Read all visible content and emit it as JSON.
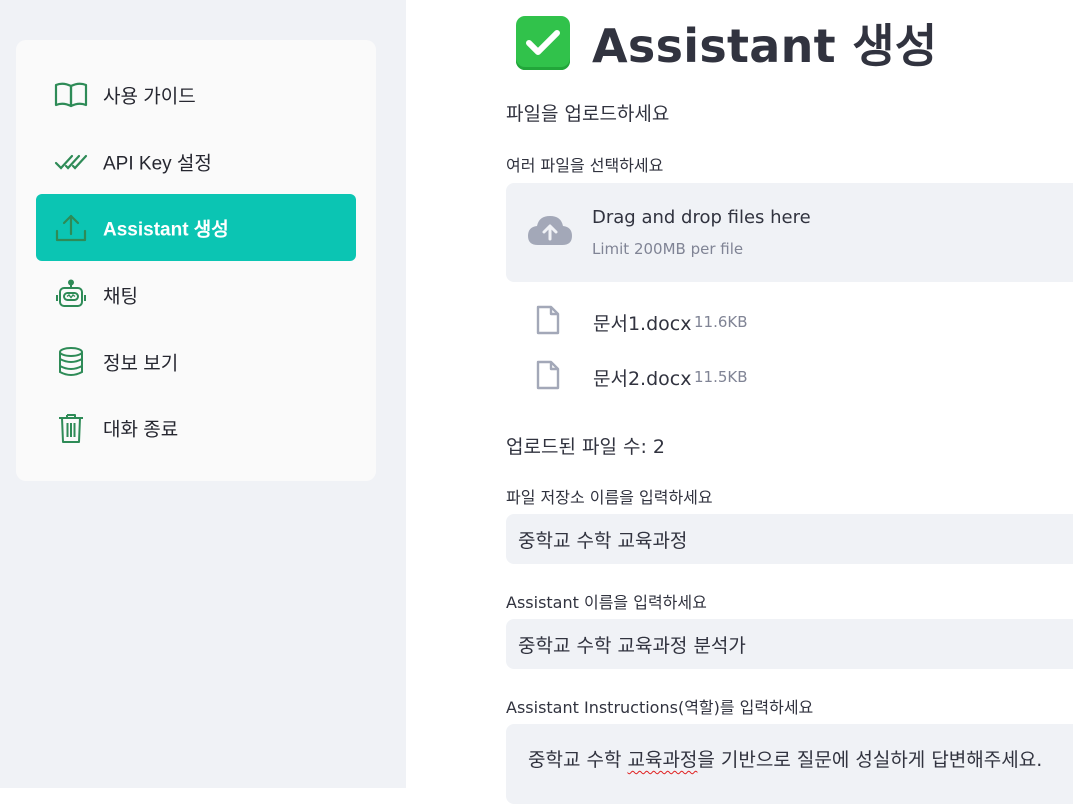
{
  "sidebar": {
    "items": [
      {
        "label": "사용 가이드",
        "icon": "book-open-icon",
        "active": false
      },
      {
        "label": "API Key 설정",
        "icon": "double-check-icon",
        "active": false
      },
      {
        "label": "Assistant 생성",
        "icon": "upload-icon",
        "active": true
      },
      {
        "label": "채팅",
        "icon": "robot-icon",
        "active": false
      },
      {
        "label": "정보 보기",
        "icon": "database-icon",
        "active": false
      },
      {
        "label": "대화 종료",
        "icon": "trash-icon",
        "active": false
      }
    ],
    "accent_color": "#0bc5b3",
    "icon_color": "#2e8b57"
  },
  "main": {
    "title_emoji": "check-mark-button-icon",
    "title": "Assistant 생성",
    "upload_header": "파일을 업로드하세요",
    "uploader_label": "여러 파일을 선택하세요",
    "dropzone": {
      "main_text": "Drag and drop files here",
      "limit_text": "Limit 200MB per file"
    },
    "files": [
      {
        "name": "문서1.docx",
        "size": "11.6KB"
      },
      {
        "name": "문서2.docx",
        "size": "11.5KB"
      }
    ],
    "upload_count": "업로드된 파일 수: 2",
    "store_label": "파일 저장소 이름을 입력하세요",
    "store_value": "중학교 수학 교육과정",
    "assistant_name_label": "Assistant 이름을 입력하세요",
    "assistant_name_value": "중학교 수학 교육과정 분석가",
    "instructions_label": "Assistant Instructions(역할)를 입력하세요",
    "instructions": {
      "before": "중학교 수학 ",
      "misspelled": "교육과정",
      "after": "을 기반으로 질문에 성실하게 답변해주세요."
    }
  }
}
